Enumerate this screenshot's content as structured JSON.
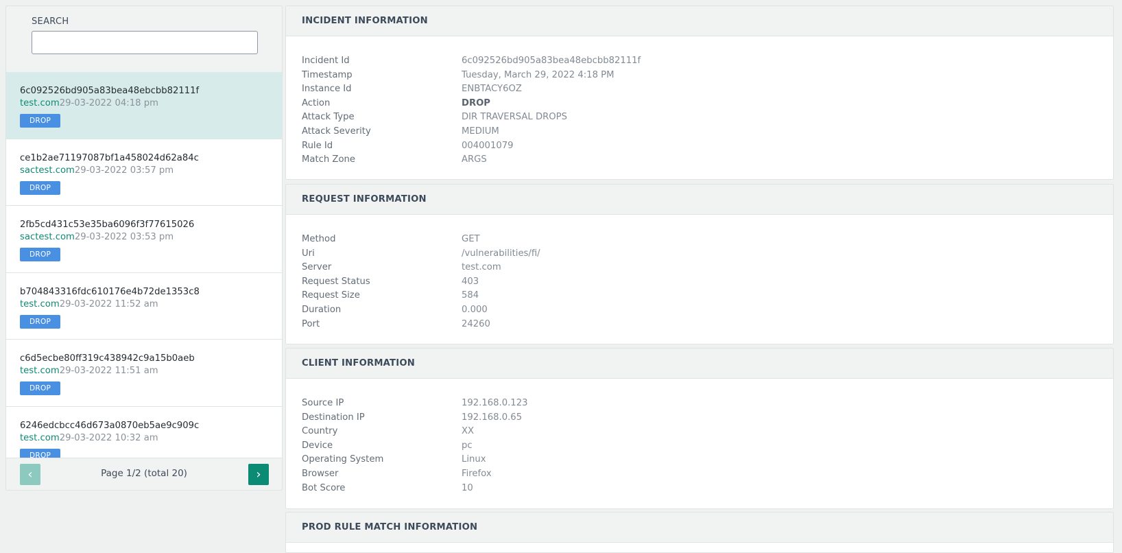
{
  "search": {
    "label": "SEARCH",
    "value": "",
    "placeholder": ""
  },
  "incidents": [
    {
      "id": "6c092526bd905a83bea48ebcbb82111f",
      "domain": "test.com",
      "date": "29-03-2022 04:18 pm",
      "action": "DROP"
    },
    {
      "id": "ce1b2ae71197087bf1a458024d62a84c",
      "domain": "sactest.com",
      "date": "29-03-2022 03:57 pm",
      "action": "DROP"
    },
    {
      "id": "2fb5cd431c53e35ba6096f3f77615026",
      "domain": "sactest.com",
      "date": "29-03-2022 03:53 pm",
      "action": "DROP"
    },
    {
      "id": "b704843316fdc610176e4b72de1353c8",
      "domain": "test.com",
      "date": "29-03-2022 11:52 am",
      "action": "DROP"
    },
    {
      "id": "c6d5ecbe80ff319c438942c9a15b0aeb",
      "domain": "test.com",
      "date": "29-03-2022 11:51 am",
      "action": "DROP"
    },
    {
      "id": "6246edcbcc46d673a0870eb5ae9c909c",
      "domain": "test.com",
      "date": "29-03-2022 10:32 am",
      "action": "DROP"
    }
  ],
  "pagination": {
    "prev_icon": "‹",
    "next_icon": "›",
    "info": "Page 1/2 (total 20)"
  },
  "incident_info": {
    "title": "INCIDENT INFORMATION",
    "rows": [
      {
        "key": "Incident Id",
        "value": "6c092526bd905a83bea48ebcbb82111f"
      },
      {
        "key": "Timestamp",
        "value": "Tuesday, March 29, 2022 4:18 PM"
      },
      {
        "key": "Instance Id",
        "value": "ENBTACY6OZ"
      },
      {
        "key": "Action",
        "value": "DROP"
      },
      {
        "key": "Attack Type",
        "value": "DIR TRAVERSAL DROPS"
      },
      {
        "key": "Attack Severity",
        "value": "MEDIUM"
      },
      {
        "key": "Rule Id",
        "value": "004001079"
      },
      {
        "key": "Match Zone",
        "value": "ARGS"
      }
    ]
  },
  "request_info": {
    "title": "REQUEST INFORMATION",
    "rows": [
      {
        "key": "Method",
        "value": "GET"
      },
      {
        "key": "Uri",
        "value": "/vulnerabilities/fi/"
      },
      {
        "key": "Server",
        "value": "test.com"
      },
      {
        "key": "Request Status",
        "value": "403"
      },
      {
        "key": "Request Size",
        "value": "584"
      },
      {
        "key": "Duration",
        "value": "0.000"
      },
      {
        "key": "Port",
        "value": "24260"
      }
    ]
  },
  "client_info": {
    "title": "CLIENT INFORMATION",
    "rows": [
      {
        "key": "Source IP",
        "value": "192.168.0.123"
      },
      {
        "key": "Destination IP",
        "value": "192.168.0.65"
      },
      {
        "key": "Country",
        "value": "XX"
      },
      {
        "key": "Device",
        "value": "pc"
      },
      {
        "key": "Operating System",
        "value": "Linux"
      },
      {
        "key": "Browser",
        "value": "Firefox"
      },
      {
        "key": "Bot Score",
        "value": "10"
      }
    ]
  },
  "prod_rule_info": {
    "title": "PROD RULE MATCH INFORMATION"
  },
  "colors": {
    "accent": "#0b8a74",
    "selected_row": "#d7ecea",
    "badge": "#4a90e2"
  }
}
